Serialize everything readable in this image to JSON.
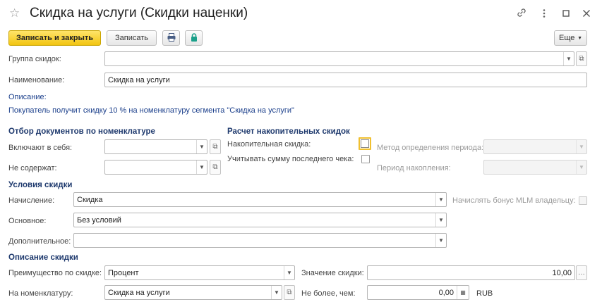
{
  "header": {
    "title": "Скидка на услуги (Скидки наценки)"
  },
  "toolbar": {
    "save_close": "Записать и закрыть",
    "save": "Записать",
    "more": "Еще"
  },
  "form": {
    "group_label": "Группа скидок:",
    "group_value": "",
    "name_label": "Наименование:",
    "name_value": "Скидка на услуги",
    "desc_label": "Описание:",
    "desc_value": "Покупатель получит скидку 10 % на номенклатуру сегмента \"Скидка на услуги\""
  },
  "filter": {
    "title": "Отбор документов по номенклатуре",
    "include_label": "Включают в себя:",
    "include_value": "",
    "exclude_label": "Не содержат:",
    "exclude_value": ""
  },
  "accum": {
    "title": "Расчет накопительных скидок",
    "cumulative_label": "Накопительная скидка:",
    "last_check_label": "Учитывать сумму последнего чека:",
    "period_method_label": "Метод определения периода:",
    "period_method_value": "",
    "period_label": "Период накопления:",
    "period_value": ""
  },
  "conditions": {
    "title": "Условия скидки",
    "accrual_label": "Начисление:",
    "accrual_value": "Скидка",
    "mlm_label": "Начислять бонус MLM владельцу:",
    "main_label": "Основное:",
    "main_value": "Без условий",
    "extra_label": "Дополнительное:",
    "extra_value": ""
  },
  "description": {
    "title": "Описание скидки",
    "advantage_label": "Преимущество по скидке:",
    "advantage_value": "Процент",
    "value_label": "Значение скидки:",
    "value_value": "10,00",
    "nomen_label": "На номенклатуру:",
    "nomen_value": "Скидка на услуги",
    "max_label": "Не более, чем:",
    "max_value": "0,00",
    "currency": "RUB"
  },
  "icons": {
    "favorite": "star-icon",
    "link": "link-icon",
    "menu": "more-vertical-icon",
    "maximize": "maximize-icon",
    "close": "close-icon",
    "print": "print-icon",
    "lock": "lock-icon"
  },
  "colors": {
    "primary_button": "#f2c511",
    "section_title": "#1f3a6e",
    "focus_border": "#f0c030"
  }
}
